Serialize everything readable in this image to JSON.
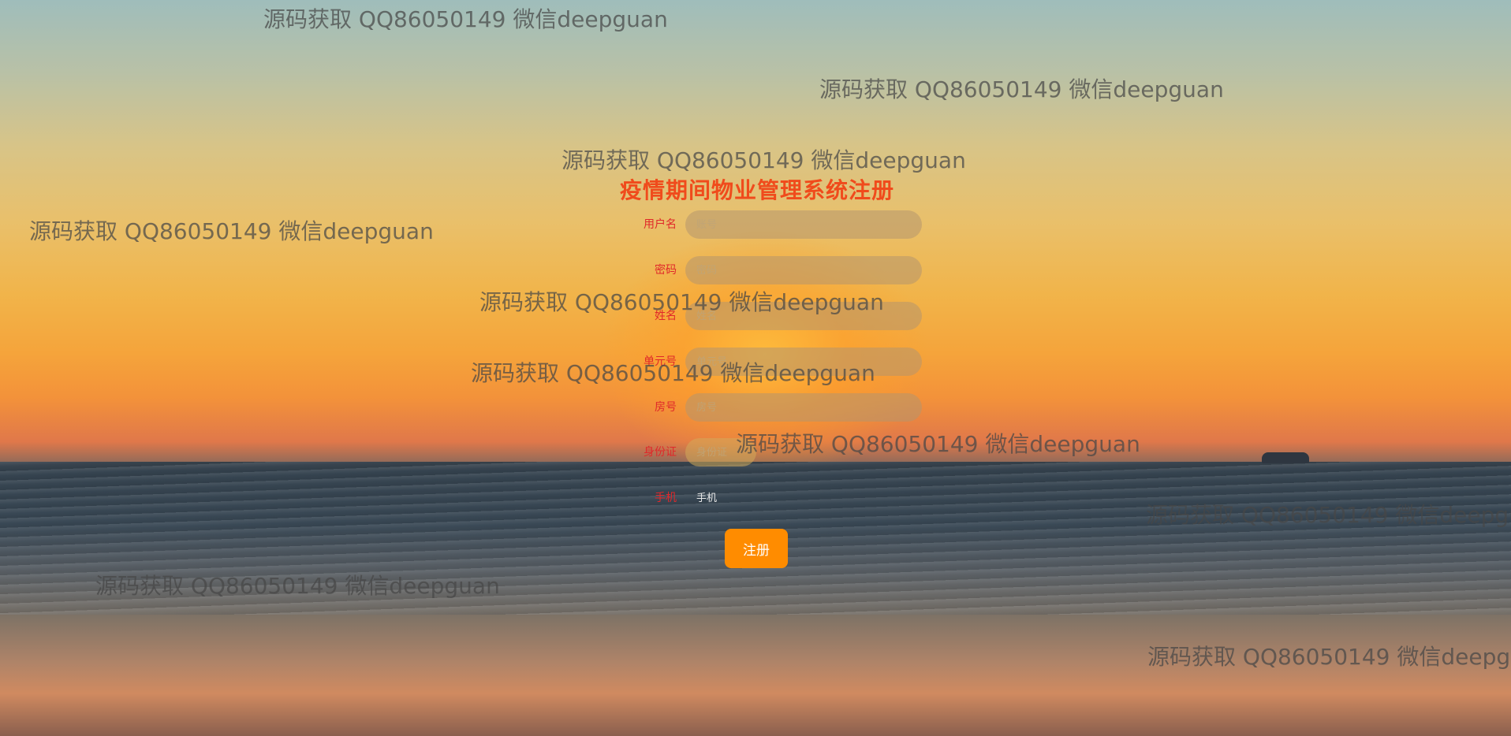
{
  "form": {
    "title": "疫情期间物业管理系统注册",
    "fields": [
      {
        "label": "用户名",
        "placeholder": "账号"
      },
      {
        "label": "密码",
        "placeholder": "密码"
      },
      {
        "label": "姓名",
        "placeholder": "姓名"
      },
      {
        "label": "单元号",
        "placeholder": "单元号"
      },
      {
        "label": "房号",
        "placeholder": "房号"
      },
      {
        "label": "身份证",
        "placeholder": "身份证"
      },
      {
        "label": "手机",
        "placeholder": "手机"
      }
    ],
    "submit_label": "注册"
  },
  "watermarks": [
    "源码获取 QQ86050149 微信deepguan",
    "源码获取 QQ86050149 微信deepguan",
    "源码获取 QQ86050149 微信deepguan",
    "源码获取 QQ86050149 微信deepguan",
    "源码获取 QQ86050149 微信deepguan",
    "源码获取 QQ86050149 微信deepguan",
    "源码获取 QQ86050149 微信deepguan",
    "源码获取 QQ86050149 微信deepguan",
    "源码获取 QQ86050149 微信deepguan",
    "源码获取 QQ86050149 微信deepguan"
  ],
  "colors": {
    "title": "#f04b1c",
    "label": "#e0282a",
    "submit_bg": "#ff8c00"
  }
}
